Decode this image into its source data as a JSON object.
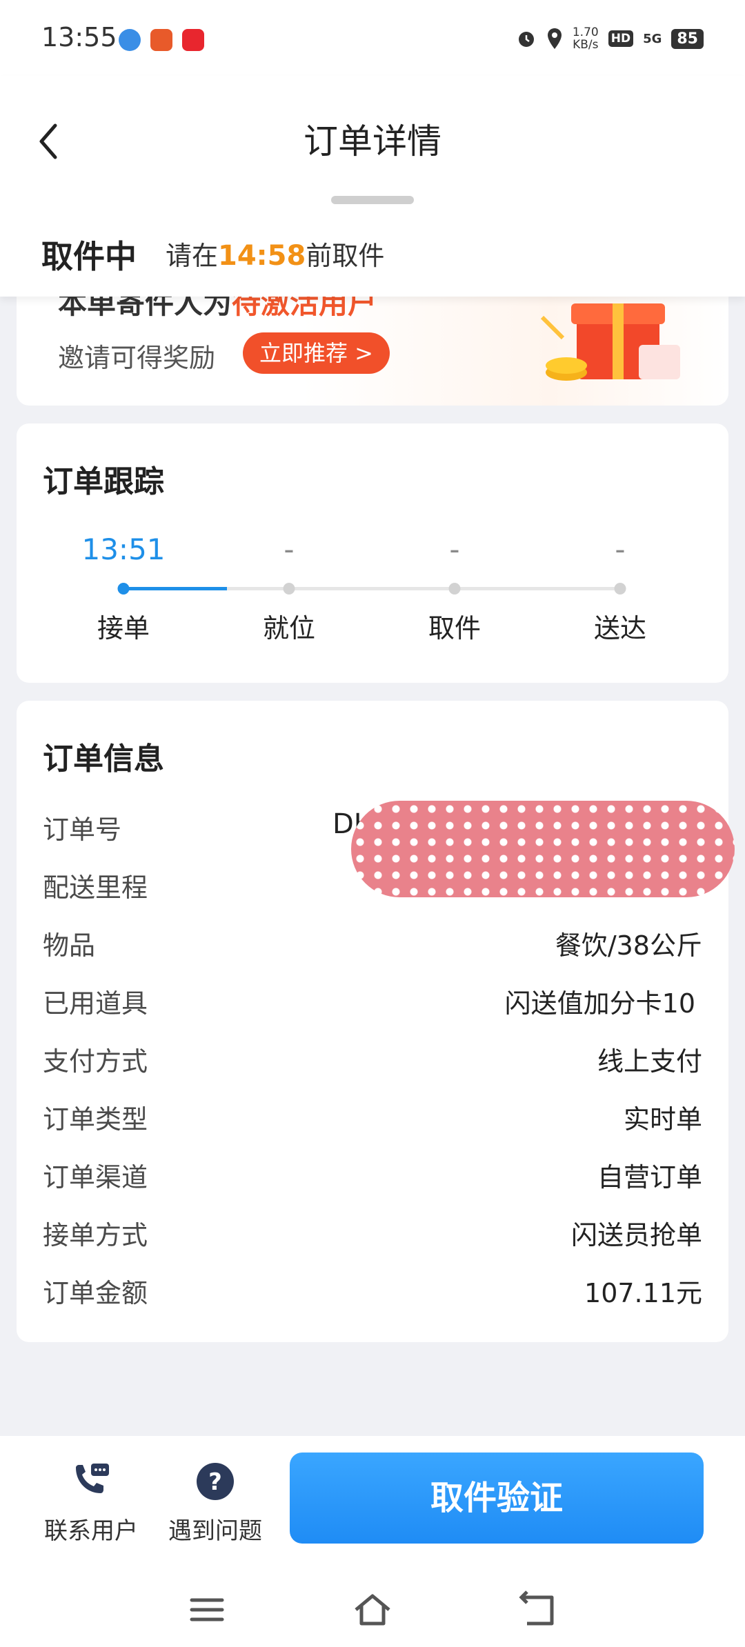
{
  "status_bar": {
    "time": "13:55",
    "net_speed": "1.70",
    "net_speed_unit": "KB/s",
    "hd": "HD",
    "network": "5G",
    "battery": "85"
  },
  "header": {
    "title": "订单详情",
    "pickup_status": "取件中",
    "pickup_hint_prefix": "请在",
    "pickup_deadline": "14:58",
    "pickup_hint_suffix": "前取件"
  },
  "promo": {
    "title_plain": "本单寄件人为",
    "title_highlight": "待激活用户",
    "subtitle": "邀请可得奖励",
    "button": "立即推荐 >"
  },
  "tracking": {
    "title": "订单跟踪",
    "steps": [
      {
        "time": "13:51",
        "label": "接单"
      },
      {
        "time": "-",
        "label": "就位"
      },
      {
        "time": "-",
        "label": "取件"
      },
      {
        "time": "-",
        "label": "送达"
      }
    ]
  },
  "order_info": {
    "title": "订单信息",
    "order_no_label": "订单号",
    "order_no_visible": "DH3",
    "rows": [
      {
        "label": "配送里程",
        "value": ""
      },
      {
        "label": "物品",
        "value": "餐饮/38公斤"
      },
      {
        "label": "已用道具",
        "value": "闪送值加分卡10"
      },
      {
        "label": "支付方式",
        "value": "线上支付"
      },
      {
        "label": "订单类型",
        "value": "实时单"
      },
      {
        "label": "订单渠道",
        "value": "自营订单"
      },
      {
        "label": "接单方式",
        "value": "闪送员抢单"
      },
      {
        "label": "订单金额",
        "value": "107.11元"
      }
    ]
  },
  "actions": {
    "contact": "联系用户",
    "problem": "遇到问题",
    "verify": "取件验证"
  },
  "colors": {
    "accent_blue": "#1e8fe8",
    "deadline_orange": "#f29116",
    "promo_red": "#f1502a"
  }
}
